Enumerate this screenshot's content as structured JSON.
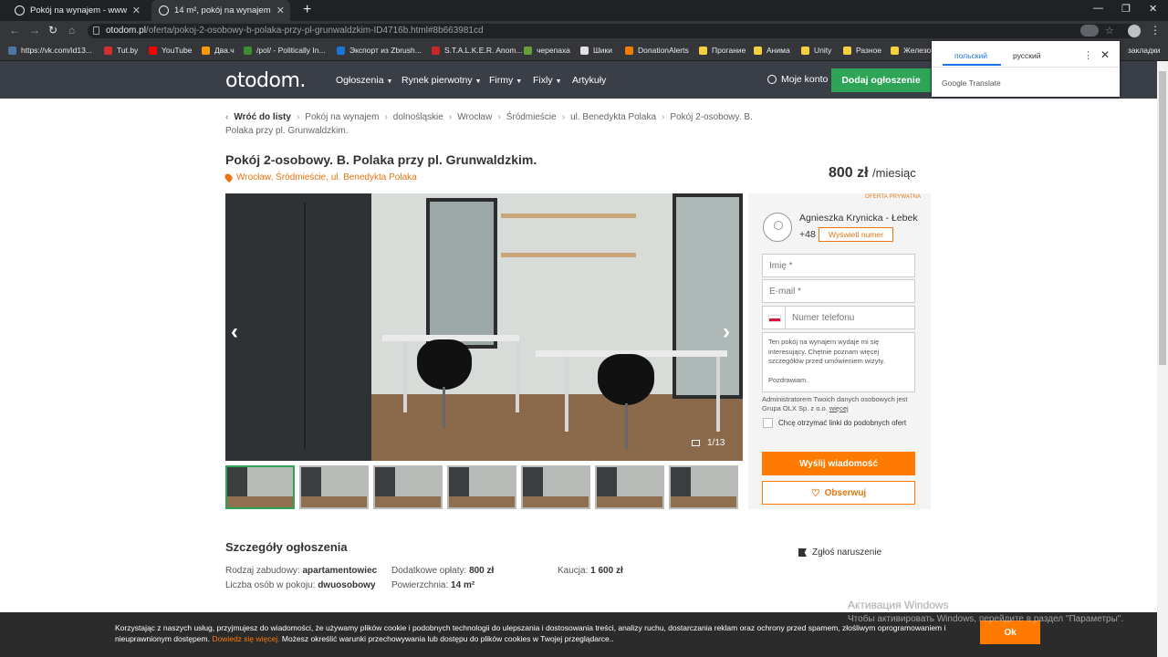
{
  "browser": {
    "tabs": [
      {
        "title": "Pokój na wynajem - www.otodom..."
      },
      {
        "title": "14 m², pokój na wynajem - Wroc..."
      }
    ],
    "new_tab": "+",
    "url_host": "otodom.pl",
    "url_path": "/oferta/pokoj-2-osobowy-b-polaka-przy-pl-grunwaldzkim-ID4716b.html#8b663981cd",
    "bookmarks": [
      {
        "label": "https://vk.com/id13...",
        "color": "#4a76a8"
      },
      {
        "label": "Tut.by",
        "color": "#d32f2f"
      },
      {
        "label": "YouTube",
        "color": "#ff0000"
      },
      {
        "label": "Два.ч",
        "color": "#ff9800"
      },
      {
        "label": "/pol/ - Politically In...",
        "color": "#3c8d2f"
      },
      {
        "label": "Экспорт из Zbrush...",
        "color": "#1976d2"
      },
      {
        "label": "S.T.A.L.K.E.R. Anom...",
        "color": "#c62828"
      },
      {
        "label": "черепаха",
        "color": "#689f38"
      },
      {
        "label": "Шики",
        "color": "#e0e0e0"
      },
      {
        "label": "DonationAlerts",
        "color": "#f57c00"
      },
      {
        "label": "Прогание",
        "color": "#f4d03f"
      },
      {
        "label": "Анима",
        "color": "#f4d03f"
      },
      {
        "label": "Unity",
        "color": "#f4d03f"
      },
      {
        "label": "Разное",
        "color": "#f4d03f"
      },
      {
        "label": "Железо",
        "color": "#f4d03f"
      }
    ],
    "other_bookmarks": "закладки"
  },
  "translate_popup": {
    "lang_source": "польский",
    "lang_target": "русский",
    "brand": "Google Translate",
    "close": "✕",
    "menu": "⋮"
  },
  "site": {
    "logo": "otodom.",
    "nav": [
      "Ogłoszenia",
      "Rynek pierwotny",
      "Firmy",
      "Fixly",
      "Artykuły"
    ],
    "account": "Moje konto",
    "add_button": "Dodaj ogłoszenie"
  },
  "breadcrumb": {
    "back": "Wróć do listy",
    "items": [
      "Pokój na wynajem",
      "dolnośląskie",
      "Wrocław",
      "Śródmieście",
      "ul. Benedykta Polaka",
      "Pokój 2-osobowy. B. Polaka przy pl. Grunwaldzkim."
    ]
  },
  "listing": {
    "title": "Pokój 2-osobowy. B. Polaka przy pl. Grunwaldzkim.",
    "location": "Wrocław, Śródmieście, ul. Benedykta Polaka",
    "price": "800 zł",
    "price_unit": "/miesiąc",
    "photo_counter": "1/13",
    "thumbnail_count": 7
  },
  "contact": {
    "private_badge": "OFERTA PRYWATNA",
    "agent_name": "Agnieszka Krynicka - Łebek",
    "phone_prefix": "+48",
    "show_number": "Wyświetl numer",
    "name_placeholder": "Imię *",
    "email_placeholder": "E-mail *",
    "phone_placeholder": "Numer telefonu",
    "message": "Ten pokój na wynajem wydaje mi się interesujący. Chętnie poznam więcej szczegółów przed umówieniem wizyty.\n\nPozdrawiam.",
    "admin_note": "Administratorem Twoich danych osobowych jest Grupa OLX Sp. z o.o.",
    "admin_more": "więcej",
    "similar_offers": "Chcę otrzymać linki do podobnych ofert",
    "send_button": "Wyślij wiadomość",
    "watch_button": "Obserwuj"
  },
  "details": {
    "title": "Szczegóły ogłoszenia",
    "report": "Zgłoś naruszenie",
    "rows": [
      {
        "label": "Rodzaj zabudowy:",
        "value": "apartamentowiec"
      },
      {
        "label": "Dodatkowe opłaty:",
        "value": "800 zł"
      },
      {
        "label": "Kaucja:",
        "value": "1 600 zł"
      },
      {
        "label": "Liczba osób w pokoju:",
        "value": "dwuosobowy"
      },
      {
        "label": "Powierzchnia:",
        "value": "14 m²"
      }
    ]
  },
  "cookie": {
    "text_before": "Korzystając z naszych usług, przyjmujesz do wiadomości, że używamy plików cookie i podobnych technologii do ulepszania i dostosowania treści, analizy ruchu, dostarczania reklam oraz ochrony przed spamem, złośliwym oprogramowaniem i nieuprawnionym dostępem.",
    "link": "Dowiedz się więcej.",
    "text_after": "Możesz określić warunki przechowywania lub dostępu do plików cookies w Twojej przeglądarce..",
    "ok": "Ok"
  },
  "windows_watermark": {
    "line1": "Активация Windows",
    "line2": "Чтобы активировать Windows, перейдите в раздел \"Параметры\"."
  }
}
